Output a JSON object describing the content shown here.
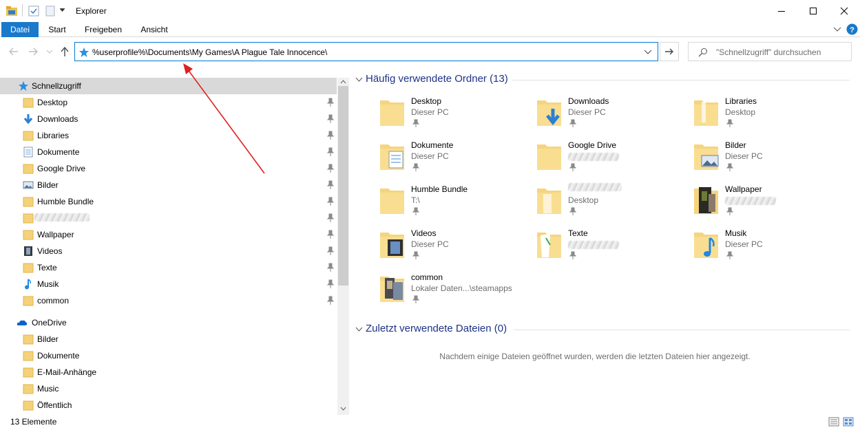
{
  "window": {
    "title": "Explorer"
  },
  "ribbon": {
    "tabs": [
      "Datei",
      "Start",
      "Freigeben",
      "Ansicht"
    ]
  },
  "address": {
    "path": "%userprofile%\\Documents\\My Games\\A Plague Tale Innocence\\"
  },
  "search": {
    "placeholder": "\"Schnellzugriff\" durchsuchen"
  },
  "sidebar": {
    "quick_access": "Schnellzugriff",
    "items": [
      "Desktop",
      "Downloads",
      "Libraries",
      "Dokumente",
      "Google Drive",
      "Bilder",
      "Humble Bundle",
      "",
      "Wallpaper",
      "Videos",
      "Texte",
      "Musik",
      "common"
    ],
    "onedrive": "OneDrive",
    "onedrive_items": [
      "Bilder",
      "Dokumente",
      "E-Mail-Anhänge",
      "Music",
      "Öffentlich"
    ]
  },
  "frequent": {
    "title": "Häufig verwendete Ordner (13)",
    "tiles": [
      {
        "name": "Desktop",
        "sub": "Dieser PC",
        "icon": "folder-icon"
      },
      {
        "name": "Downloads",
        "sub": "Dieser PC",
        "icon": "downloads-folder-icon"
      },
      {
        "name": "Libraries",
        "sub": "Desktop",
        "icon": "libraries-folder-icon"
      },
      {
        "name": "Dokumente",
        "sub": "Dieser PC",
        "icon": "documents-folder-icon"
      },
      {
        "name": "Google Drive",
        "sub": "",
        "icon": "folder-icon"
      },
      {
        "name": "Bilder",
        "sub": "Dieser PC",
        "icon": "pictures-folder-icon"
      },
      {
        "name": "Humble Bundle",
        "sub": "T:\\",
        "icon": "folder-icon"
      },
      {
        "name": "",
        "sub": "Desktop",
        "icon": "folder-icon"
      },
      {
        "name": "Wallpaper",
        "sub": "",
        "icon": "image-folder-icon"
      },
      {
        "name": "Videos",
        "sub": "Dieser PC",
        "icon": "videos-folder-icon"
      },
      {
        "name": "Texte",
        "sub": "",
        "icon": "text-folder-icon"
      },
      {
        "name": "Musik",
        "sub": "Dieser PC",
        "icon": "music-folder-icon"
      },
      {
        "name": "common",
        "sub": "Lokaler Daten...\\steamapps",
        "icon": "image-folder-icon"
      }
    ]
  },
  "recent": {
    "title": "Zuletzt verwendete Dateien (0)",
    "empty_text": "Nachdem einige Dateien geöffnet wurden, werden die letzten Dateien hier angezeigt."
  },
  "status": {
    "count": "13 Elemente"
  },
  "colors": {
    "accent": "#1979ca",
    "group_title": "#1e3287",
    "folder": "#f5d27a",
    "selection": "#d9d9d9",
    "annotation_arrow": "#e02020"
  }
}
